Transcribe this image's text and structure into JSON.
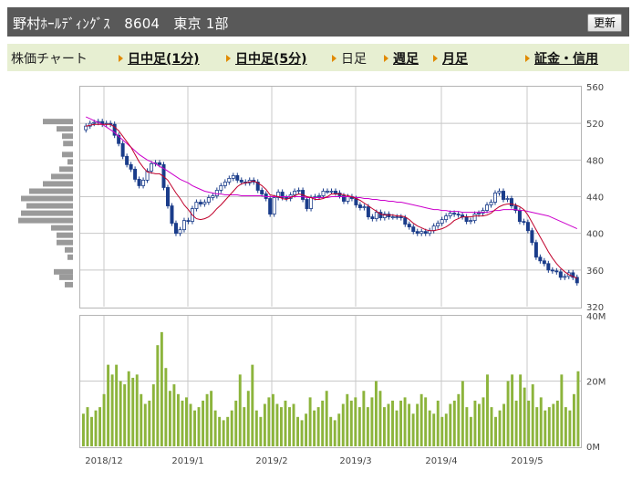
{
  "header": {
    "title": "野村ﾎｰﾙﾃﾞｨﾝｸﾞｽ　8604　東京 1部",
    "refresh_label": "更新"
  },
  "tabs": [
    {
      "label": "株価チャート",
      "link": false,
      "arrow": false
    },
    {
      "label": "日中足(1分)",
      "link": true,
      "arrow": true
    },
    {
      "label": "日中足(5分)",
      "link": true,
      "arrow": true
    },
    {
      "label": "日足",
      "link": false,
      "arrow": true
    },
    {
      "label": "週足",
      "link": true,
      "arrow": true
    },
    {
      "label": "月足",
      "link": true,
      "arrow": true
    },
    {
      "label": "証金・信用",
      "link": true,
      "arrow": true
    }
  ],
  "colors": {
    "up_candle": "#ffffff",
    "down_candle": "#1a3c8a",
    "ma_short": "#c0002a",
    "ma_long": "#cc00cc",
    "volume_bar": "#8cb43c",
    "profile_bar": "#9a9a9a",
    "grid": "#c8c8c8"
  },
  "chart_data": [
    {
      "type": "candlestick",
      "ylim": [
        320,
        560
      ],
      "y_ticks": [
        "560",
        "520",
        "480",
        "440",
        "400",
        "360",
        "320"
      ],
      "x_ticks": [
        "2018/12",
        "2019/1",
        "2019/2",
        "2019/3",
        "2019/4",
        "2019/5"
      ],
      "closes": [
        517,
        520,
        521,
        522,
        519,
        520,
        519,
        507,
        498,
        484,
        475,
        470,
        459,
        452,
        458,
        468,
        476,
        477,
        475,
        450,
        430,
        411,
        400,
        404,
        414,
        413,
        427,
        434,
        432,
        434,
        439,
        441,
        447,
        452,
        456,
        460,
        463,
        458,
        456,
        455,
        458,
        456,
        447,
        443,
        438,
        421,
        439,
        445,
        439,
        438,
        442,
        446,
        447,
        437,
        427,
        439,
        440,
        441,
        446,
        446,
        446,
        444,
        441,
        435,
        440,
        438,
        431,
        428,
        429,
        418,
        416,
        423,
        417,
        421,
        418,
        418,
        418,
        417,
        410,
        407,
        402,
        400,
        402,
        400,
        403,
        408,
        411,
        415,
        419,
        422,
        421,
        420,
        418,
        413,
        414,
        421,
        422,
        425,
        431,
        434,
        444,
        446,
        437,
        438,
        430,
        425,
        413,
        412,
        403,
        390,
        374,
        370,
        367,
        360,
        359,
        358,
        352,
        353,
        357,
        352,
        346
      ],
      "ma_short": [
        517,
        518,
        519,
        519,
        519,
        519,
        519,
        516,
        512,
        506,
        500,
        494,
        486,
        478,
        472,
        467,
        466,
        465,
        465,
        462,
        458,
        451,
        444,
        438,
        431,
        426,
        420,
        416,
        415,
        416,
        418,
        422,
        427,
        431,
        436,
        441,
        446,
        451,
        454,
        455,
        456,
        457,
        455,
        452,
        448,
        442,
        441,
        440,
        438,
        437,
        439,
        441,
        443,
        442,
        440,
        439,
        437,
        437,
        438,
        440,
        443,
        443,
        443,
        442,
        441,
        440,
        438,
        436,
        433,
        430,
        427,
        424,
        421,
        420,
        420,
        420,
        419,
        419,
        418,
        415,
        411,
        408,
        406,
        404,
        403,
        403,
        404,
        405,
        407,
        410,
        414,
        416,
        418,
        418,
        418,
        419,
        419,
        419,
        420,
        422,
        426,
        429,
        431,
        432,
        432,
        431,
        429,
        426,
        420,
        412,
        404,
        396,
        388,
        380,
        373,
        367,
        362,
        358,
        355,
        353,
        351
      ],
      "ma_long": [
        527,
        525,
        523,
        521,
        519,
        516,
        513,
        510,
        506,
        502,
        498,
        494,
        490,
        486,
        483,
        480,
        478,
        476,
        473,
        471,
        468,
        465,
        462,
        459,
        457,
        455,
        452,
        450,
        448,
        446,
        445,
        444,
        443,
        443,
        442,
        442,
        442,
        442,
        441,
        441,
        441,
        441,
        441,
        441,
        440,
        440,
        440,
        440,
        440,
        440,
        440,
        440,
        440,
        440,
        439,
        439,
        439,
        439,
        439,
        439,
        440,
        440,
        440,
        440,
        440,
        440,
        439,
        439,
        438,
        438,
        437,
        437,
        436,
        436,
        435,
        435,
        434,
        434,
        433,
        432,
        431,
        430,
        429,
        428,
        427,
        426,
        426,
        425,
        425,
        424,
        424,
        424,
        423,
        423,
        423,
        423,
        423,
        423,
        423,
        424,
        425,
        425,
        426,
        426,
        426,
        426,
        425,
        425,
        424,
        423,
        422,
        421,
        420,
        419,
        417,
        415,
        413,
        411,
        409,
        407,
        405
      ],
      "price_profile": [
        {
          "price": 522,
          "weight": 0.55
        },
        {
          "price": 514,
          "weight": 0.3
        },
        {
          "price": 506,
          "weight": 0.2
        },
        {
          "price": 498,
          "weight": 0.18
        },
        {
          "price": 486,
          "weight": 0.2
        },
        {
          "price": 478,
          "weight": 0.1
        },
        {
          "price": 470,
          "weight": 0.25
        },
        {
          "price": 462,
          "weight": 0.4
        },
        {
          "price": 454,
          "weight": 0.55
        },
        {
          "price": 446,
          "weight": 0.8
        },
        {
          "price": 438,
          "weight": 0.95
        },
        {
          "price": 430,
          "weight": 0.85
        },
        {
          "price": 422,
          "weight": 0.95
        },
        {
          "price": 414,
          "weight": 1.0
        },
        {
          "price": 406,
          "weight": 0.4
        },
        {
          "price": 398,
          "weight": 0.3
        },
        {
          "price": 390,
          "weight": 0.3
        },
        {
          "price": 382,
          "weight": 0.15
        },
        {
          "price": 374,
          "weight": 0.1
        },
        {
          "price": 358,
          "weight": 0.35
        },
        {
          "price": 352,
          "weight": 0.25
        },
        {
          "price": 344,
          "weight": 0.15
        }
      ]
    },
    {
      "type": "bar",
      "ylim": [
        0,
        40
      ],
      "y_ticks": [
        "40M",
        "20M",
        "0M"
      ],
      "x_ticks": [
        "2018/12",
        "2019/1",
        "2019/2",
        "2019/3",
        "2019/4",
        "2019/5"
      ],
      "volumes": [
        10,
        12,
        9,
        11,
        12,
        16,
        25,
        22,
        25,
        20,
        19,
        23,
        21,
        22,
        16,
        13,
        14,
        19,
        31,
        35,
        24,
        17,
        19,
        16,
        14,
        15,
        13,
        11,
        12,
        14,
        16,
        17,
        11,
        9,
        8,
        9,
        11,
        14,
        22,
        12,
        17,
        25,
        11,
        9,
        13,
        15,
        16,
        13,
        12,
        14,
        12,
        13,
        9,
        8,
        10,
        15,
        11,
        12,
        14,
        17,
        9,
        8,
        10,
        13,
        16,
        14,
        15,
        12,
        17,
        12,
        15,
        20,
        17,
        12,
        13,
        14,
        11,
        14,
        15,
        13,
        10,
        13,
        16,
        15,
        11,
        10,
        14,
        9,
        10,
        13,
        14,
        16,
        20,
        12,
        9,
        14,
        13,
        15,
        22,
        12,
        9,
        11,
        13,
        20,
        22,
        14,
        22,
        18,
        14,
        19,
        12,
        15,
        11,
        12,
        13,
        14,
        22,
        12,
        11,
        16,
        23
      ]
    }
  ]
}
